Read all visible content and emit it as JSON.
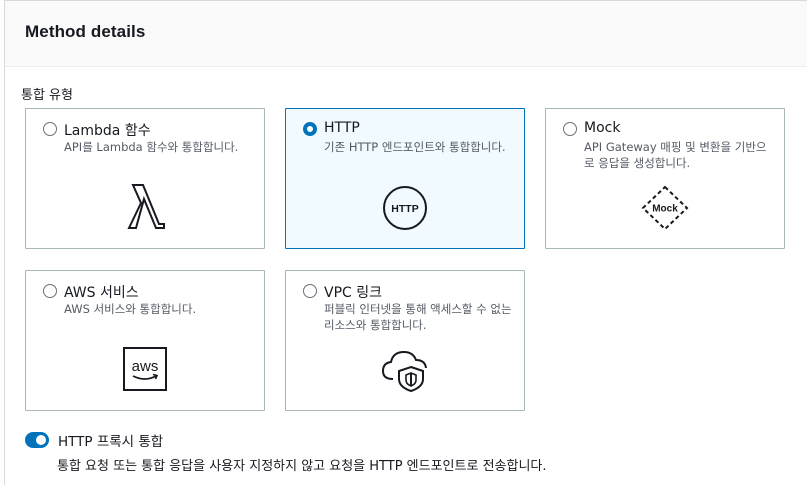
{
  "panel": {
    "title": "Method details"
  },
  "integration_type": {
    "label": "통합 유형",
    "options": [
      {
        "title": "Lambda 함수",
        "description": "API를 Lambda 함수와 통합합니다.",
        "icon": "lambda-icon",
        "selected": false
      },
      {
        "title": "HTTP",
        "description": "기존 HTTP 엔드포인트와 통합합니다.",
        "icon": "http-icon",
        "icon_text": "HTTP",
        "selected": true
      },
      {
        "title": "Mock",
        "description": "API Gateway 매핑 및 변환을 기반으로 응답을 생성합니다.",
        "icon": "mock-icon",
        "icon_text": "Mock",
        "selected": false
      },
      {
        "title": "AWS 서비스",
        "description": "AWS 서비스와 통합합니다.",
        "icon": "aws-icon",
        "icon_text": "aws",
        "selected": false
      },
      {
        "title": "VPC 링크",
        "description": "퍼블릭 인터넷을 통해 액세스할 수 없는 리소스와 통합합니다.",
        "icon": "cloud-shield-icon",
        "selected": false
      }
    ]
  },
  "proxy": {
    "label": "HTTP 프록시 통합",
    "enabled": true,
    "description": "통합 요청 또는 통합 응답을 사용자 지정하지 않고 요청을 HTTP 엔드포인트로 전송합니다."
  },
  "colors": {
    "accent": "#0073bb",
    "selected_bg": "#f1faff",
    "border": "#aab7b8"
  }
}
